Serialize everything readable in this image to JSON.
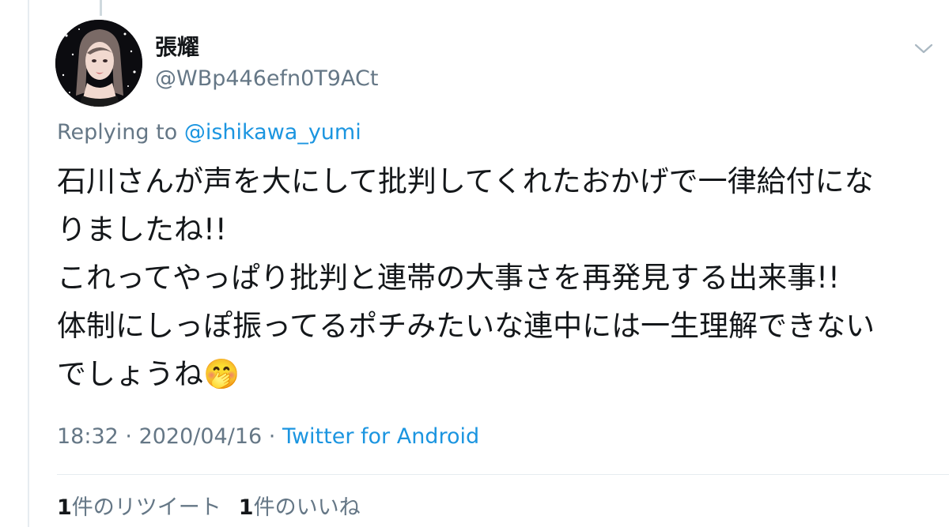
{
  "author": {
    "display_name": "張耀",
    "handle": "@WBp446efn0T9ACt"
  },
  "reply": {
    "prefix": "Replying to ",
    "mention": "@ishikawa_yumi"
  },
  "tweet": {
    "lines": [
      "石川さんが声を大にして批判してくれたおかげで一律給付にな",
      "りましたね!!",
      "これってやっぱり批判と連帯の大事さを再発見する出来事!!",
      "体制にしっぽ振ってるポチみたいな連中には一生理解できない",
      "でしょうね"
    ],
    "emoji": "🤭"
  },
  "meta": {
    "time": "18:32",
    "separator": " · ",
    "date": "2020/04/16",
    "source": "Twitter for Android"
  },
  "stats": {
    "retweets_count": "1",
    "retweets_label": "件のリツイート",
    "likes_count": "1",
    "likes_label": "件のいいね"
  },
  "icons": {
    "more_menu": "chevron-down-icon",
    "emoji": "face-with-hand-over-mouth"
  },
  "colors": {
    "link": "#1b95e0",
    "secondary_text": "#657786",
    "primary_text": "#14171a",
    "divider": "#e6ecf0"
  }
}
